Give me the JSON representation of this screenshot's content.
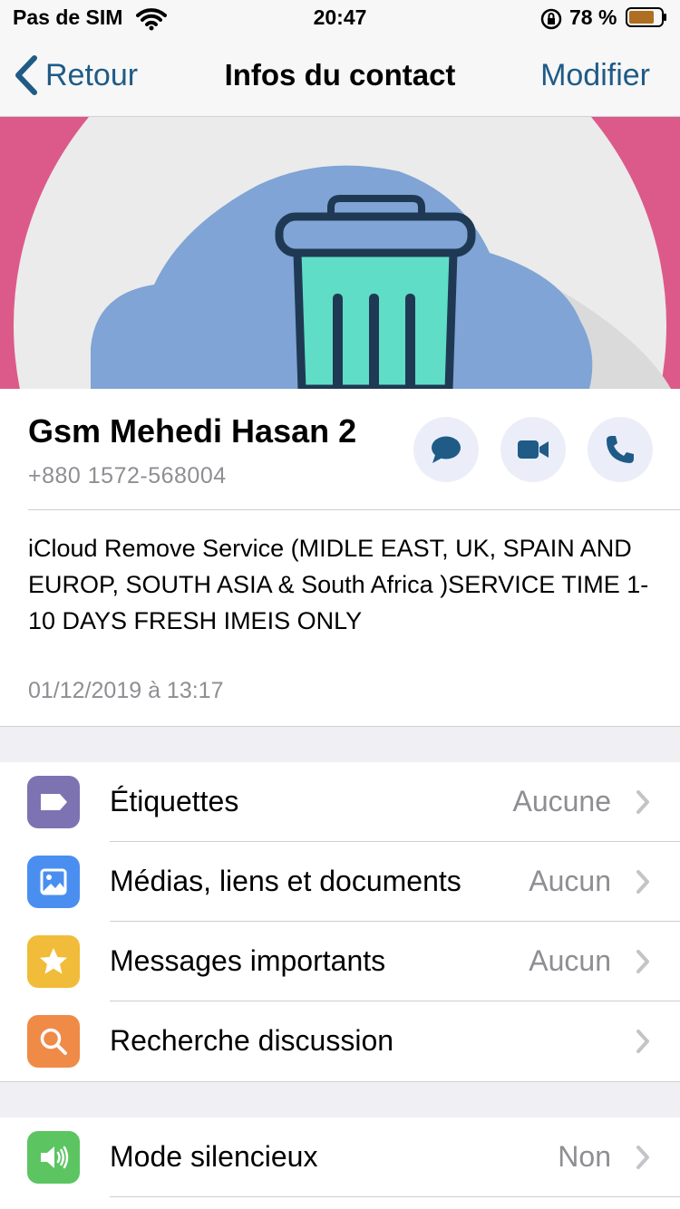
{
  "status_bar": {
    "carrier": "Pas de SIM",
    "time": "20:47",
    "battery_percent": "78 %",
    "battery_level": 0.78,
    "icons": [
      "wifi-icon",
      "orientation-lock-icon",
      "battery-icon"
    ]
  },
  "nav": {
    "back_label": "Retour",
    "title": "Infos du contact",
    "edit_label": "Modifier"
  },
  "contact": {
    "name": "Gsm Mehedi Hasan 2",
    "phone": "+880 1572-568004",
    "actions": [
      "message-icon",
      "video-call-icon",
      "phone-icon"
    ]
  },
  "about": {
    "text": "iCloud Remove Service (MIDLE EAST, UK, SPAIN AND EUROP, SOUTH ASIA & South Africa )SERVICE TIME 1-10 DAYS FRESH IMEIS ONLY",
    "date": "01/12/2019 à 13:17"
  },
  "menu": [
    {
      "icon": "label-icon",
      "color": "#7d73b3",
      "label": "Étiquettes",
      "value": "Aucune"
    },
    {
      "icon": "image-icon",
      "color": "#4a8ff0",
      "label": "Médias, liens et documents",
      "value": "Aucun"
    },
    {
      "icon": "star-icon",
      "color": "#f1bc3a",
      "label": "Messages importants",
      "value": "Aucun"
    },
    {
      "icon": "search-icon",
      "color": "#ef8a47",
      "label": "Recherche discussion",
      "value": ""
    }
  ],
  "settings": [
    {
      "icon": "speaker-icon",
      "color": "#5cc561",
      "label": "Mode silencieux",
      "value": "Non"
    }
  ],
  "colors": {
    "accent": "#1f5b86",
    "action_bg": "#ebeef9",
    "photo_bg": "#dc5a89"
  }
}
